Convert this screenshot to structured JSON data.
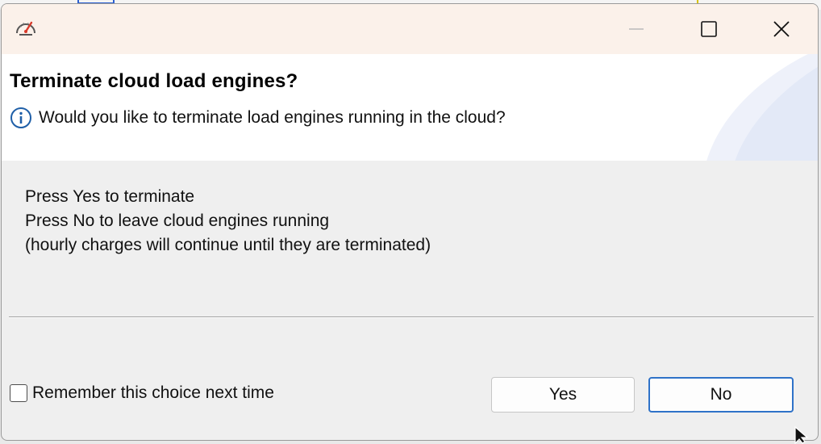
{
  "dialog": {
    "title": "Terminate cloud load engines?",
    "message": "Would you like to terminate load engines running in the cloud?",
    "body_lines": [
      "Press Yes to terminate",
      "Press No to leave cloud engines running",
      "(hourly charges will continue until they are terminated)"
    ],
    "remember_label": "Remember this choice next time",
    "remember_checked": false,
    "yes_label": "Yes",
    "no_label": "No",
    "default_button": "No"
  },
  "window_controls": {
    "minimize_icon": "minimize-icon",
    "maximize_icon": "maximize-icon",
    "close_icon": "close-icon"
  },
  "icons": {
    "app_icon": "speedometer-icon",
    "message_icon": "info-icon"
  },
  "colors": {
    "titlebar": "#fbf1ea",
    "header": "#ffffff",
    "body": "#efefef",
    "default_button_border": "#2f72c8",
    "info_icon": "#1f5fa8",
    "app_icon_accent": "#d93a2b"
  }
}
